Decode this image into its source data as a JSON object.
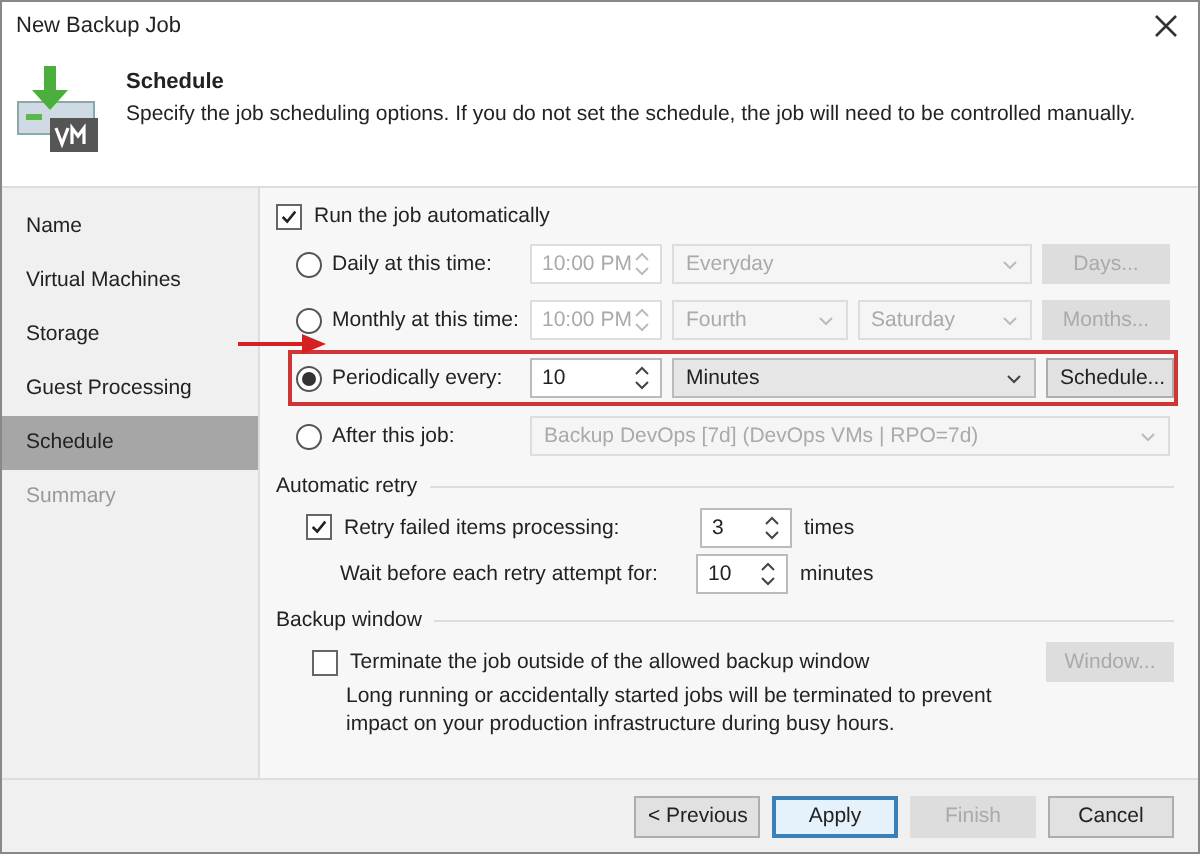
{
  "window": {
    "title": "New Backup Job"
  },
  "header": {
    "title": "Schedule",
    "description": "Specify the job scheduling options. If you do not set the schedule, the job will need to be controlled manually."
  },
  "nav": [
    {
      "label": "Name",
      "selected": false,
      "disabled": false
    },
    {
      "label": "Virtual Machines",
      "selected": false,
      "disabled": false
    },
    {
      "label": "Storage",
      "selected": false,
      "disabled": false
    },
    {
      "label": "Guest Processing",
      "selected": false,
      "disabled": false
    },
    {
      "label": "Schedule",
      "selected": true,
      "disabled": false
    },
    {
      "label": "Summary",
      "selected": false,
      "disabled": true
    }
  ],
  "run_automatically": {
    "label": "Run the job automatically",
    "checked": true
  },
  "schedule_options": [
    {
      "label": "Daily at this time:",
      "selected": false,
      "highlighted": false,
      "controls": [
        {
          "kind": "spin",
          "value": "10:00 PM",
          "disabled": true
        },
        {
          "kind": "dropdown",
          "value": "Everyday",
          "disabled": true
        },
        {
          "kind": "button",
          "value": "Days...",
          "disabled": true
        }
      ]
    },
    {
      "label": "Monthly at this time:",
      "selected": false,
      "highlighted": false,
      "controls": [
        {
          "kind": "spin",
          "value": "10:00 PM",
          "disabled": true
        },
        {
          "kind": "dropdown",
          "value": "Fourth",
          "disabled": true
        },
        {
          "kind": "dropdown",
          "value": "Saturday",
          "disabled": true
        },
        {
          "kind": "button",
          "value": "Months...",
          "disabled": true
        }
      ]
    },
    {
      "label": "Periodically every:",
      "selected": true,
      "highlighted": true,
      "controls": [
        {
          "kind": "spin",
          "value": "10",
          "disabled": false
        },
        {
          "kind": "dropdown",
          "value": "Minutes",
          "disabled": false
        },
        {
          "kind": "button",
          "value": "Schedule...",
          "disabled": false
        }
      ]
    },
    {
      "label": "After this job:",
      "selected": false,
      "highlighted": false,
      "controls": [
        {
          "kind": "dropdown",
          "value": "Backup DevOps [7d] (DevOps VMs | RPO=7d)",
          "disabled": true
        }
      ]
    }
  ],
  "automatic_retry": {
    "title": "Automatic retry",
    "retry_label": "Retry failed items processing:",
    "retry_checked": true,
    "retry_value": "3",
    "retry_unit": "times",
    "wait_label": "Wait before each retry attempt for:",
    "wait_value": "10",
    "wait_unit": "minutes"
  },
  "backup_window": {
    "title": "Backup window",
    "label": "Terminate the job outside of the allowed backup window",
    "checked": false,
    "button": "Window...",
    "button_disabled": true,
    "description": "Long running or accidentally started jobs will be terminated to prevent impact on your production infrastructure during busy hours."
  },
  "buttons": [
    {
      "label": "< Previous",
      "disabled": false,
      "default": false
    },
    {
      "label": "Apply",
      "disabled": false,
      "default": true
    },
    {
      "label": "Finish",
      "disabled": true,
      "default": false
    },
    {
      "label": "Cancel",
      "disabled": false,
      "default": false
    }
  ]
}
